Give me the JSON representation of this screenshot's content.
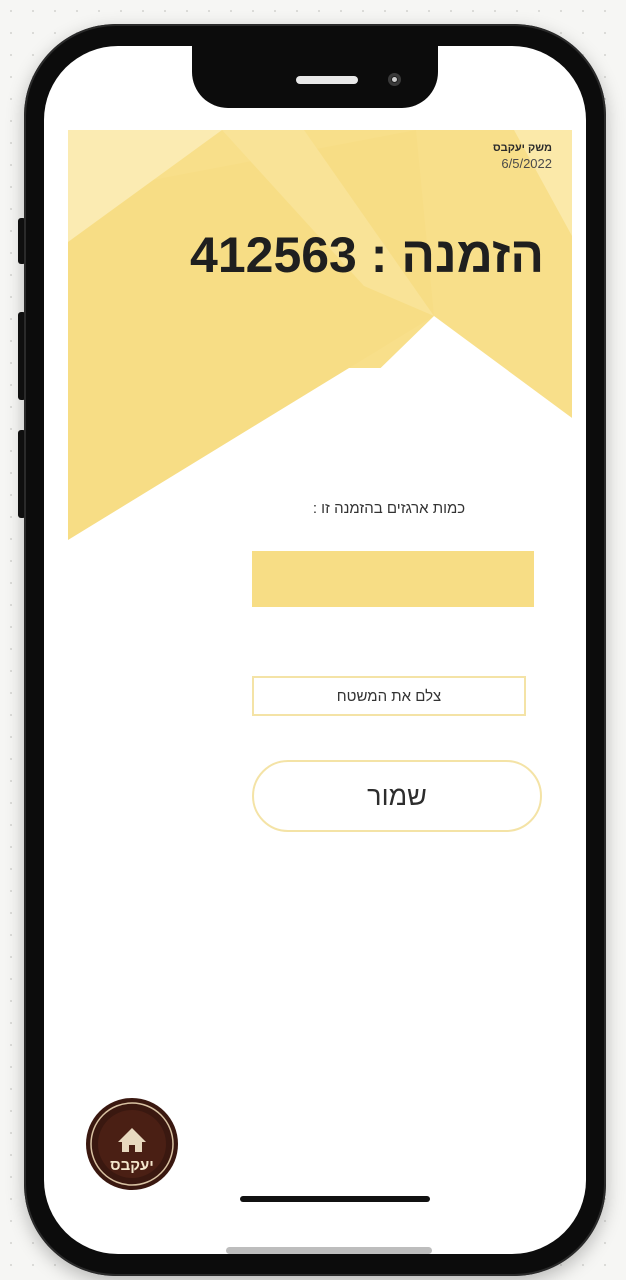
{
  "header": {
    "farm_name": "משק יעקבס",
    "date": "6/5/2022"
  },
  "order": {
    "title": "412563 : הזמנה"
  },
  "form": {
    "quantity_label": "כמות ארגזים בהזמנה זו :",
    "quantity_value": "",
    "photo_button_label": "צלם את המשטח",
    "save_button_label": "שמור"
  },
  "logo": {
    "icon": "farm-logo-icon",
    "text": "יעקבס"
  },
  "colors": {
    "accent_yellow": "#f7dd85",
    "light_yellow": "#fbebb2",
    "button_border": "#f4e3a6",
    "logo_brown": "#4a1f14"
  }
}
